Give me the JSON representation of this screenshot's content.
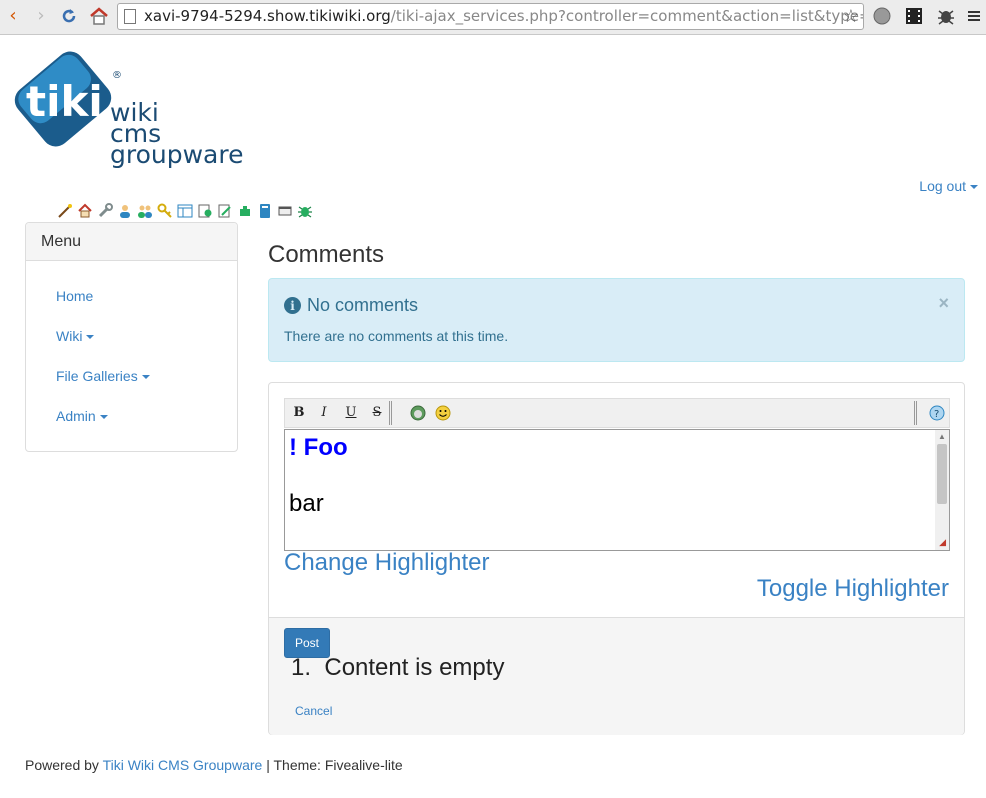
{
  "browser": {
    "url_host": "xavi-9794-5294.show.tikiwiki.org",
    "url_path": "/tiki-ajax_services.php?controller=comment&action=list&type=wi"
  },
  "logo": {
    "mark_text": "tiki",
    "registered": "®",
    "line1": "wiki",
    "line2": "cms",
    "line3": "groupware"
  },
  "header": {
    "logout_label": "Log out"
  },
  "menu": {
    "title": "Menu",
    "items": [
      {
        "label": "Home",
        "dropdown": false
      },
      {
        "label": "Wiki",
        "dropdown": true
      },
      {
        "label": "File Galleries",
        "dropdown": true
      },
      {
        "label": "Admin",
        "dropdown": true
      }
    ]
  },
  "main": {
    "title": "Comments",
    "alert": {
      "title": "No comments",
      "body": "There are no comments at this time.",
      "close": "×"
    },
    "toolbar": {
      "bold": "B",
      "italic": "I",
      "underline": "U",
      "strike": "S"
    },
    "editor": {
      "line1": "! Foo",
      "line2": "bar"
    },
    "change_highlighter": "Change Highlighter",
    "toggle_highlighter": "Toggle Highlighter",
    "post_label": "Post",
    "error_number": "1.",
    "error_text": "Content is empty",
    "cancel_label": "Cancel"
  },
  "footer": {
    "powered_by": "Powered by",
    "link": "Tiki Wiki CMS Groupware",
    "theme": "| Theme: Fivealive-lite"
  },
  "colors": {
    "link": "#3a82c4",
    "alert_bg": "#d9edf7",
    "alert_text": "#31708f",
    "primary": "#337ab7",
    "logo_blue": "#1b4b73"
  }
}
